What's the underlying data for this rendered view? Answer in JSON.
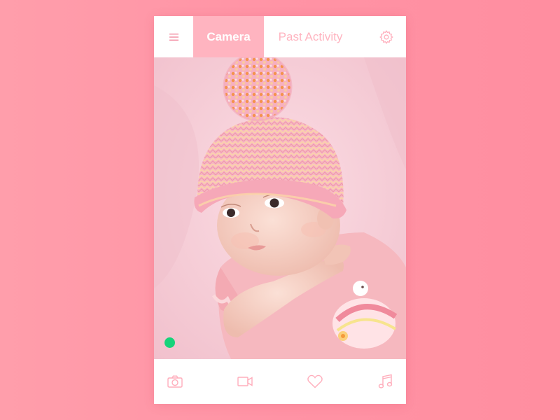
{
  "colors": {
    "background": "#ff93a5",
    "accent": "#ffb4c0",
    "live_indicator": "#16d37a",
    "card": "#ffffff"
  },
  "header": {
    "menu_icon": "hamburger-menu-icon",
    "tabs": [
      {
        "label": "Camera",
        "active": true
      },
      {
        "label": "Past Activity",
        "active": false
      }
    ],
    "settings_icon": "gear-icon"
  },
  "feed": {
    "subject": "baby-camera-feed",
    "live_status": "live"
  },
  "toolbar": {
    "items": [
      {
        "icon": "camera-icon"
      },
      {
        "icon": "video-camera-icon"
      },
      {
        "icon": "heart-icon"
      },
      {
        "icon": "music-note-icon"
      }
    ]
  }
}
